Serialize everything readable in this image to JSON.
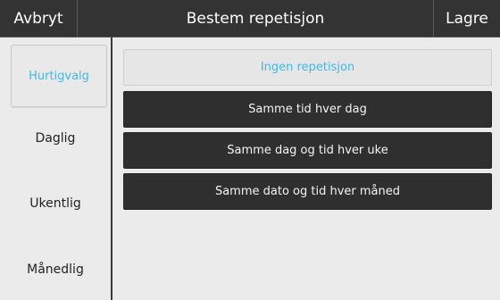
{
  "header": {
    "cancel_label": "Avbryt",
    "title": "Bestem repetisjon",
    "save_label": "Lagre"
  },
  "sidebar": {
    "items": [
      {
        "label": "Hurtigvalg"
      },
      {
        "label": "Daglig"
      },
      {
        "label": "Ukentlig"
      },
      {
        "label": "Månedlig"
      }
    ]
  },
  "options": [
    {
      "label": "Ingen repetisjon"
    },
    {
      "label": "Samme tid hver dag"
    },
    {
      "label": "Samme dag og tid hver uke"
    },
    {
      "label": "Samme dato og tid hver måned"
    }
  ],
  "colors": {
    "accent": "#3db8f0",
    "header_bg": "#333333",
    "option_bg": "#2f2f2f",
    "page_bg": "#ebebeb"
  }
}
